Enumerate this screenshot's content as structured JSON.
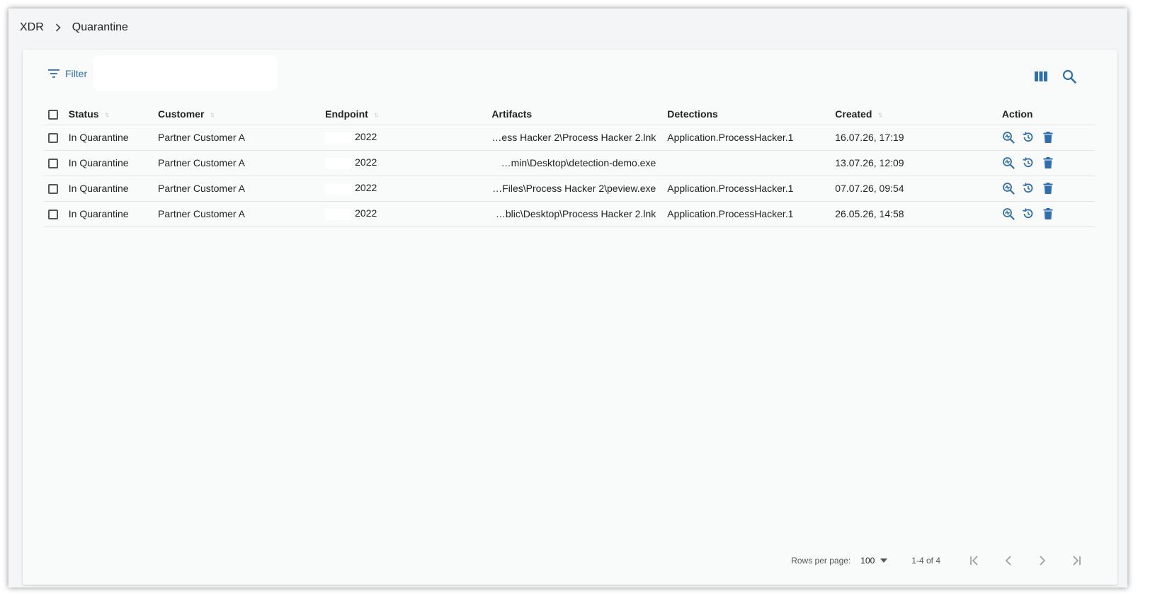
{
  "breadcrumb": {
    "root": "XDR",
    "current": "Quarantine"
  },
  "toolbar": {
    "filter_label": "Filter",
    "filter_placeholder": ""
  },
  "columns": {
    "status": "Status",
    "customer": "Customer",
    "endpoint": "Endpoint",
    "artifacts": "Artifacts",
    "detections": "Detections",
    "created": "Created",
    "action": "Action"
  },
  "rows": [
    {
      "status": "In Quarantine",
      "customer": "Partner Customer A",
      "endpoint": "2022",
      "artifact": "…ess Hacker 2\\Process Hacker 2.lnk",
      "detection": "Application.ProcessHacker.1",
      "created": "16.07.26, 17:19"
    },
    {
      "status": "In Quarantine",
      "customer": "Partner Customer A",
      "endpoint": "2022",
      "artifact": "…min\\Desktop\\detection-demo.exe",
      "detection": "",
      "created": "13.07.26, 12:09"
    },
    {
      "status": "In Quarantine",
      "customer": "Partner Customer A",
      "endpoint": "2022",
      "artifact": "…Files\\Process Hacker 2\\peview.exe",
      "detection": "Application.ProcessHacker.1",
      "created": "07.07.26, 09:54"
    },
    {
      "status": "In Quarantine",
      "customer": "Partner Customer A",
      "endpoint": "2022",
      "artifact": "…blic\\Desktop\\Process Hacker 2.lnk",
      "detection": "Application.ProcessHacker.1",
      "created": "26.05.26, 14:58"
    }
  ],
  "footer": {
    "rows_per_page_label": "Rows per page:",
    "rows_per_page_value": "100",
    "range": "1-4 of 4"
  },
  "icons": {
    "filter": "filter-icon",
    "columns": "view-columns-icon",
    "search": "search-icon",
    "analyze": "analyze-icon",
    "restore": "restore-icon",
    "delete": "delete-icon"
  },
  "colors": {
    "accent": "#2f6fb0",
    "background": "#f4f5f6",
    "card": "#f9fafa"
  }
}
